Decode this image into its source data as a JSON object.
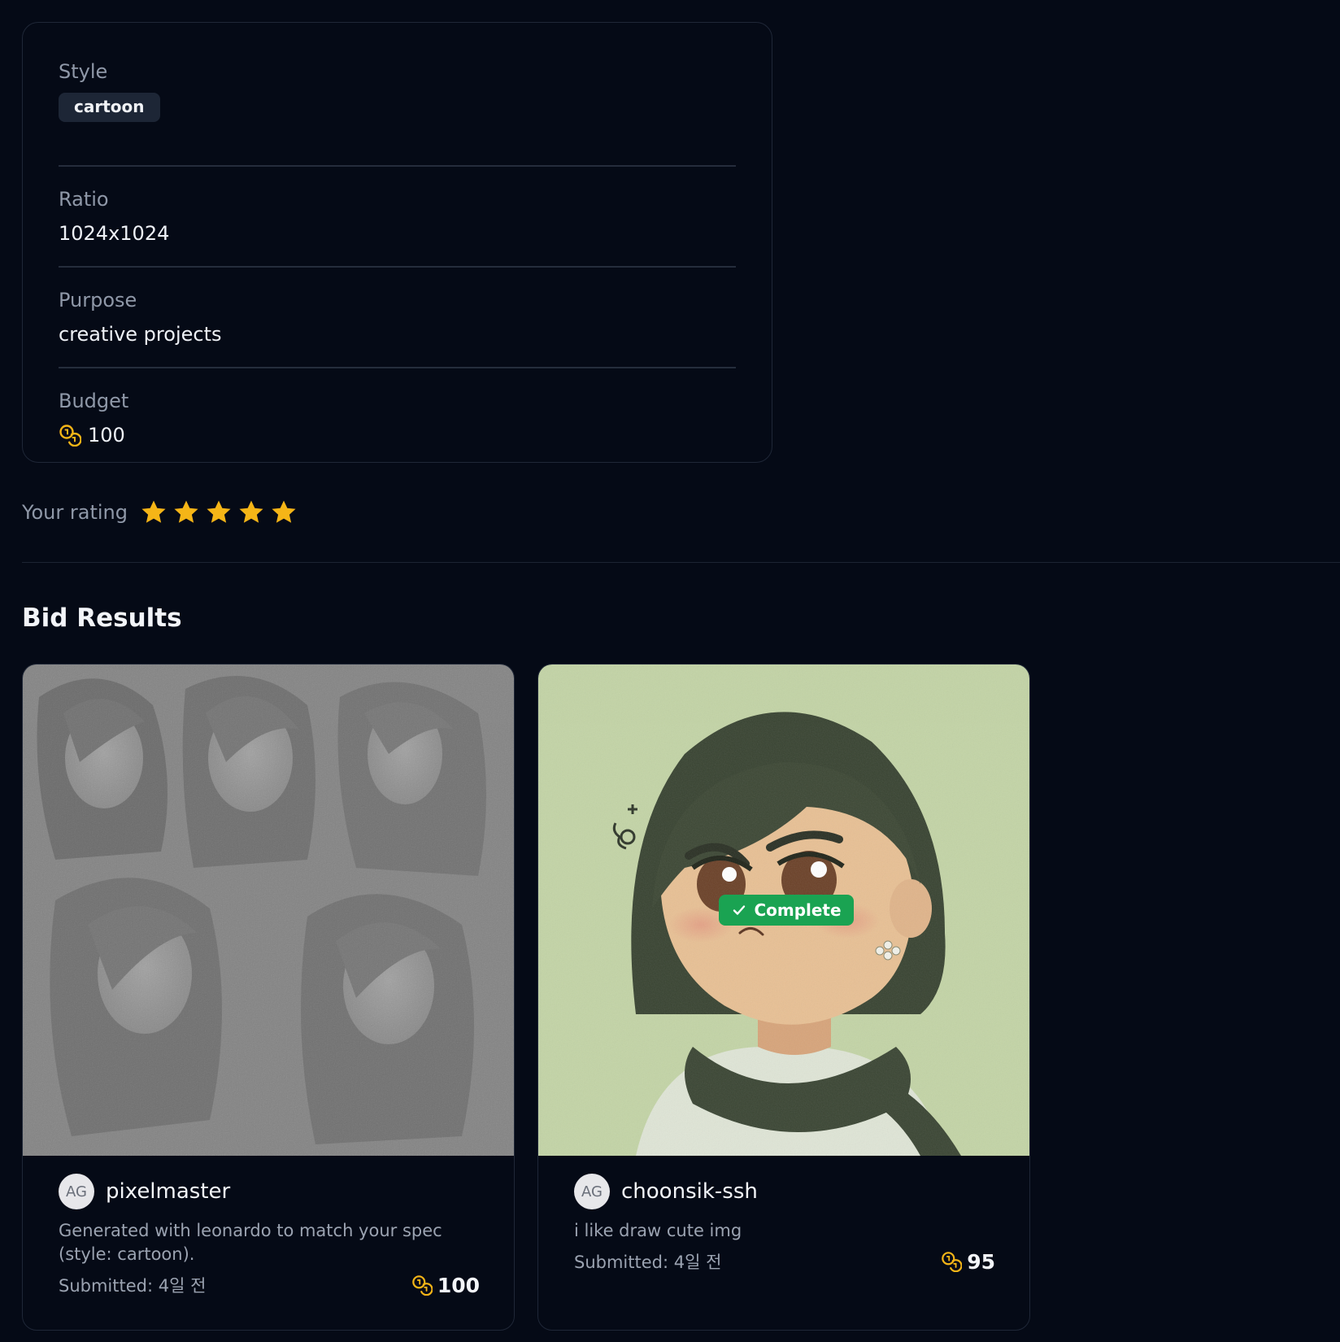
{
  "spec": {
    "style": {
      "label": "Style",
      "value": "cartoon"
    },
    "ratio": {
      "label": "Ratio",
      "value": "1024x1024"
    },
    "purpose": {
      "label": "Purpose",
      "value": "creative projects"
    },
    "budget": {
      "label": "Budget",
      "value": "100",
      "icon": "coin-icon"
    }
  },
  "rating": {
    "label": "Your rating",
    "stars": 5,
    "max": 5,
    "color": "#f5b517"
  },
  "bids": {
    "title": "Bid Results",
    "items": [
      {
        "avatar": "AG",
        "name": "pixelmaster",
        "description": "Generated with leonardo to match your spec (style: cartoon).",
        "submitted": "Submitted: 4일 전",
        "amount": "100",
        "image": "grayscale-sketch-of-five-dark-haired-women"
      },
      {
        "avatar": "AG",
        "name": "choonsik-ssh",
        "description": "i like draw cute img",
        "submitted": "Submitted: 4일 전",
        "amount": "95",
        "badge": "Complete",
        "image": "cartoon-girl-with-scarf-on-green-background"
      }
    ]
  },
  "colors": {
    "accent_coin": "#f5b517",
    "complete_green": "#1aa352",
    "background": "#050a16"
  }
}
